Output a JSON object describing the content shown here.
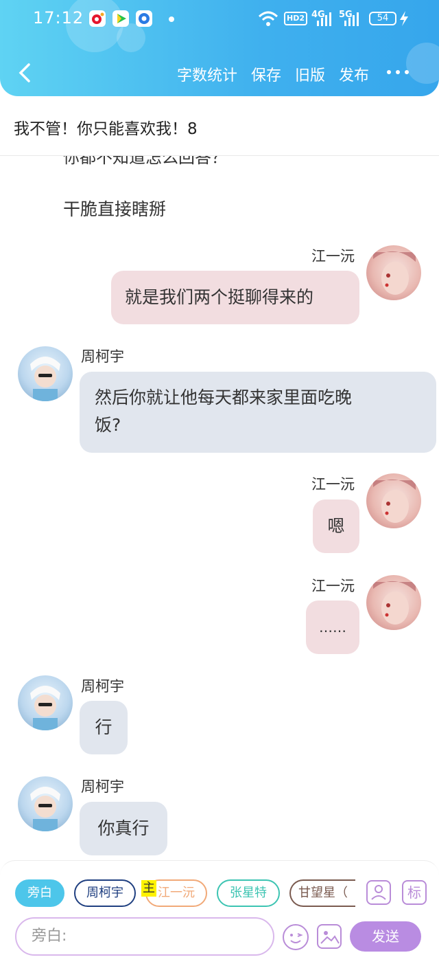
{
  "status_bar": {
    "time": "17:12",
    "battery": "54",
    "hd": "HD2",
    "net1": "4G",
    "net2": "5G"
  },
  "nav": {
    "items": [
      "字数统计",
      "保存",
      "旧版",
      "发布"
    ]
  },
  "title": "我不管！你只能喜欢我！8",
  "chat": {
    "cut_text": "你都不知道怎么回答？",
    "narration": "干脆直接瞎掰",
    "messages": [
      {
        "side": "right",
        "name": "江一沅",
        "text": "就是我们两个挺聊得来的"
      },
      {
        "side": "left",
        "name": "周柯宇",
        "text_line1": "然后你就让他每天都来家里面吃晚",
        "text_line2": "饭?"
      },
      {
        "side": "right",
        "name": "江一沅",
        "text": "嗯"
      },
      {
        "side": "right",
        "name": "江一沅",
        "text": "……"
      },
      {
        "side": "left",
        "name": "周柯宇",
        "text": "行"
      },
      {
        "side": "left",
        "name": "周柯宇",
        "text": "你真行"
      }
    ]
  },
  "roles": [
    {
      "label": "旁白",
      "color": "#4dc6ea"
    },
    {
      "label": "周柯宇",
      "color": "#1f3f80"
    },
    {
      "label": "江一沅",
      "color": "#f1a978"
    },
    {
      "label": "张星特",
      "color": "#3cc4b2"
    },
    {
      "label": "甘望星（",
      "color": "#7a5a4f"
    }
  ],
  "main_badge": "主",
  "tools": {
    "mark": "标"
  },
  "input": {
    "placeholder": "旁白:"
  },
  "send_label": "发送"
}
